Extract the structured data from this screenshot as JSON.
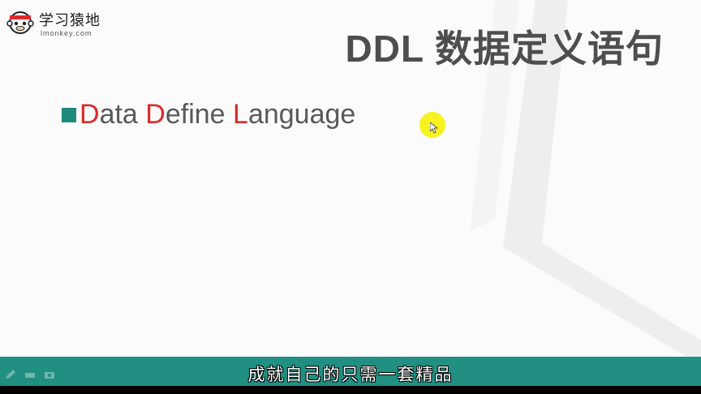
{
  "logo": {
    "title": "学习猿地",
    "subtitle": "lmonkey.com"
  },
  "slide": {
    "title": "DDL 数据定义语句",
    "bullet": {
      "part1_initial": "D",
      "part1_rest": "ata ",
      "part2_initial": "D",
      "part2_rest": "efine ",
      "part3_initial": "L",
      "part3_rest": "anguage"
    }
  },
  "bottom_bar": {
    "subtitle": "成就自己的只需一套精品"
  },
  "colors": {
    "accent_teal": "#1e8a7c",
    "bar_teal": "#218f82",
    "highlight_red": "#d92b2b",
    "title_gray": "#4e4e4e",
    "cursor_yellow": "#f7f220"
  },
  "icons": {
    "cursor": "cursor-arrow-icon",
    "cursor_highlight": "cursor-highlight",
    "pen": "pen-icon",
    "eraser": "eraser-icon",
    "camera": "camera-icon"
  }
}
